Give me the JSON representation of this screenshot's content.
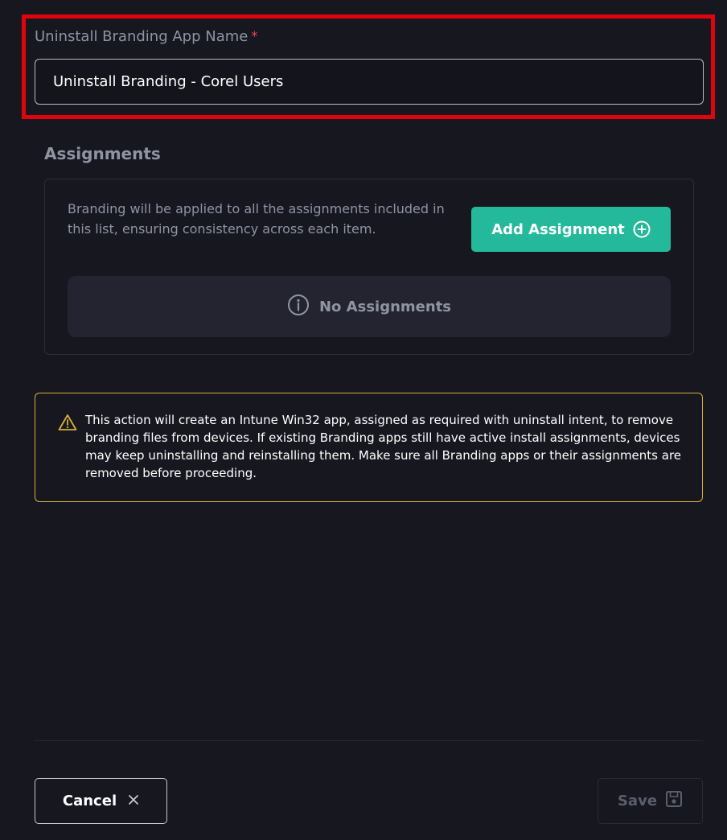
{
  "form": {
    "name_label": "Uninstall Branding App Name",
    "required_marker": "*",
    "name_value": "Uninstall Branding - Corel Users"
  },
  "assignments": {
    "heading": "Assignments",
    "description": "Branding will be applied to all the assignments included in this list, ensuring consistency across each item.",
    "add_button_label": "Add Assignment",
    "add_button_icon": "plus-circle-icon",
    "empty_label": "No Assignments",
    "empty_icon": "info-circle-icon"
  },
  "warning": {
    "icon": "warning-triangle-icon",
    "text": "This action will create an Intune Win32 app, assigned as required with uninstall intent, to remove branding files from devices. If existing Branding apps still have active install assignments, devices may keep uninstalling and reinstalling them. Make sure all Branding apps or their assignments are removed before proceeding."
  },
  "footer": {
    "cancel_label": "Cancel",
    "cancel_icon": "close-icon",
    "save_label": "Save",
    "save_icon": "save-icon",
    "save_disabled": true
  },
  "colors": {
    "background": "#171720",
    "highlight": "#e0050c",
    "accent": "#23b99a",
    "warning": "#d9b03a",
    "required": "#e24b4b",
    "muted_text": "#8f94a3"
  }
}
